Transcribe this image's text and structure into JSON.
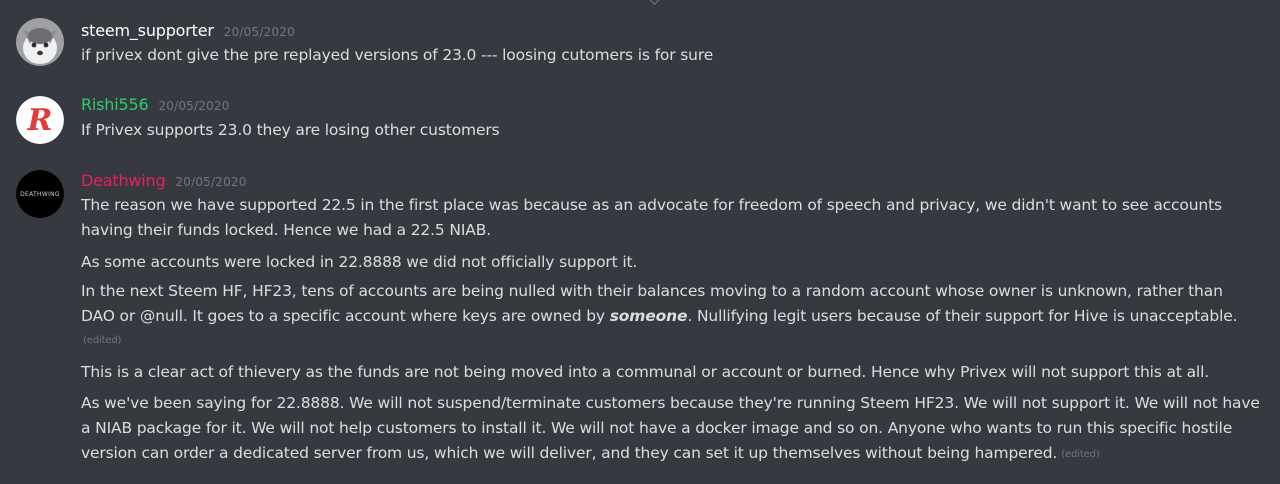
{
  "messages": [
    {
      "username": "steem_supporter",
      "username_color": "#ffffff",
      "timestamp": "20/05/2020",
      "avatar_icon": "husky-dog-avatar",
      "paragraphs": [
        {
          "text": "if privex dont give the pre replayed versions of 23.0 ---  loosing cutomers is for sure"
        }
      ]
    },
    {
      "username": "Rishi556",
      "username_color": "#2ecc71",
      "timestamp": "20/05/2020",
      "avatar_icon": "red-r-logo-avatar",
      "paragraphs": [
        {
          "text": "If Privex supports 23.0 they are losing other customers"
        }
      ]
    },
    {
      "username": "Deathwing",
      "username_color": "#e91e63",
      "timestamp": "20/05/2020",
      "avatar_icon": "deathwing-logo-avatar",
      "avatar_text": "DEATHWING",
      "paragraphs": [
        {
          "text": "The reason we have supported 22.5 in the first place was because as an advocate for freedom of speech and privacy, we didn't want to see accounts having their funds locked. Hence we had a 22.5 NIAB."
        },
        {
          "text": "As some accounts were locked in 22.8888 we did not officially support it."
        },
        {
          "text_before": "In the next Steem HF, HF23, tens of accounts are being nulled with their balances moving to a random account whose owner is unknown, rather than DAO or @null. It goes to a specific account where keys are owned by ",
          "text_emphasis": "someone",
          "text_after": ". Nullifying legit users because of their support for Hive is unacceptable.",
          "edited_label": "(edited)"
        },
        {
          "text": "This is a clear act of thievery as the funds are not being moved into a communal or account or burned. Hence why Privex will not support this at all."
        },
        {
          "text": "As we've been saying for 22.8888. We will not suspend/terminate customers because they're running Steem HF23. We will not support it. We will not have a NIAB package for it. We will not help customers to install it. We will not have a docker image and so on. Anyone who wants to run this specific hostile version can order a dedicated server from us, which we will deliver, and they can set it up themselves without being hampered.",
          "edited_label": "(edited)"
        }
      ]
    }
  ],
  "colors": {
    "background": "#36393f",
    "text": "#dcddde",
    "muted": "#72767d"
  }
}
